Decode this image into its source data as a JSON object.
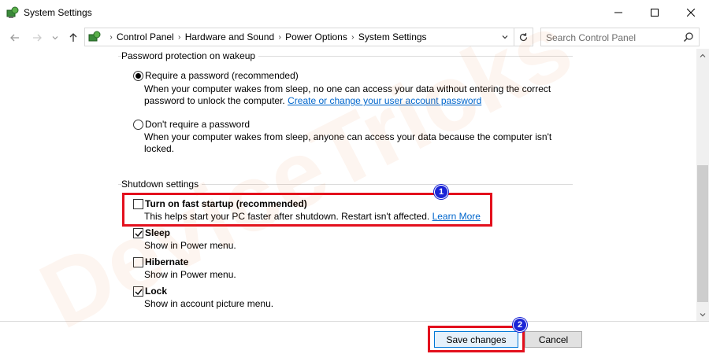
{
  "window": {
    "title": "System Settings",
    "app_icon": "power-options-icon"
  },
  "titlebar_buttons": {
    "minimize": "minimize-icon",
    "maximize": "maximize-icon",
    "close": "close-icon"
  },
  "nav": {
    "breadcrumbs": [
      "Control Panel",
      "Hardware and Sound",
      "Power Options",
      "System Settings"
    ],
    "search_placeholder": "Search Control Panel"
  },
  "password_section": {
    "title": "Password protection on wakeup",
    "options": [
      {
        "label": "Require a password (recommended)",
        "selected": true,
        "desc_line1": "When your computer wakes from sleep, no one can access your data without entering the correct",
        "desc_line2": "password to unlock the computer.",
        "link": "Create or change your user account password"
      },
      {
        "label": "Don't require a password",
        "selected": false,
        "desc_line1": "When your computer wakes from sleep, anyone can access your data because the computer isn't",
        "desc_line2": "locked."
      }
    ]
  },
  "shutdown_section": {
    "title": "Shutdown settings",
    "items": [
      {
        "label": "Turn on fast startup (recommended)",
        "checked": false,
        "desc": "This helps start your PC faster after shutdown. Restart isn't affected.",
        "link": "Learn More"
      },
      {
        "label": "Sleep",
        "checked": true,
        "desc": "Show in Power menu."
      },
      {
        "label": "Hibernate",
        "checked": false,
        "desc": "Show in Power menu."
      },
      {
        "label": "Lock",
        "checked": true,
        "desc": "Show in account picture menu."
      }
    ]
  },
  "footer": {
    "save_label": "Save changes",
    "cancel_label": "Cancel"
  },
  "annotations": {
    "badge1": "1",
    "badge2": "2",
    "highlight_color": "#e3101d",
    "badge_color": "#1b25d6"
  },
  "watermark": {
    "text": "DeviceTricks"
  }
}
